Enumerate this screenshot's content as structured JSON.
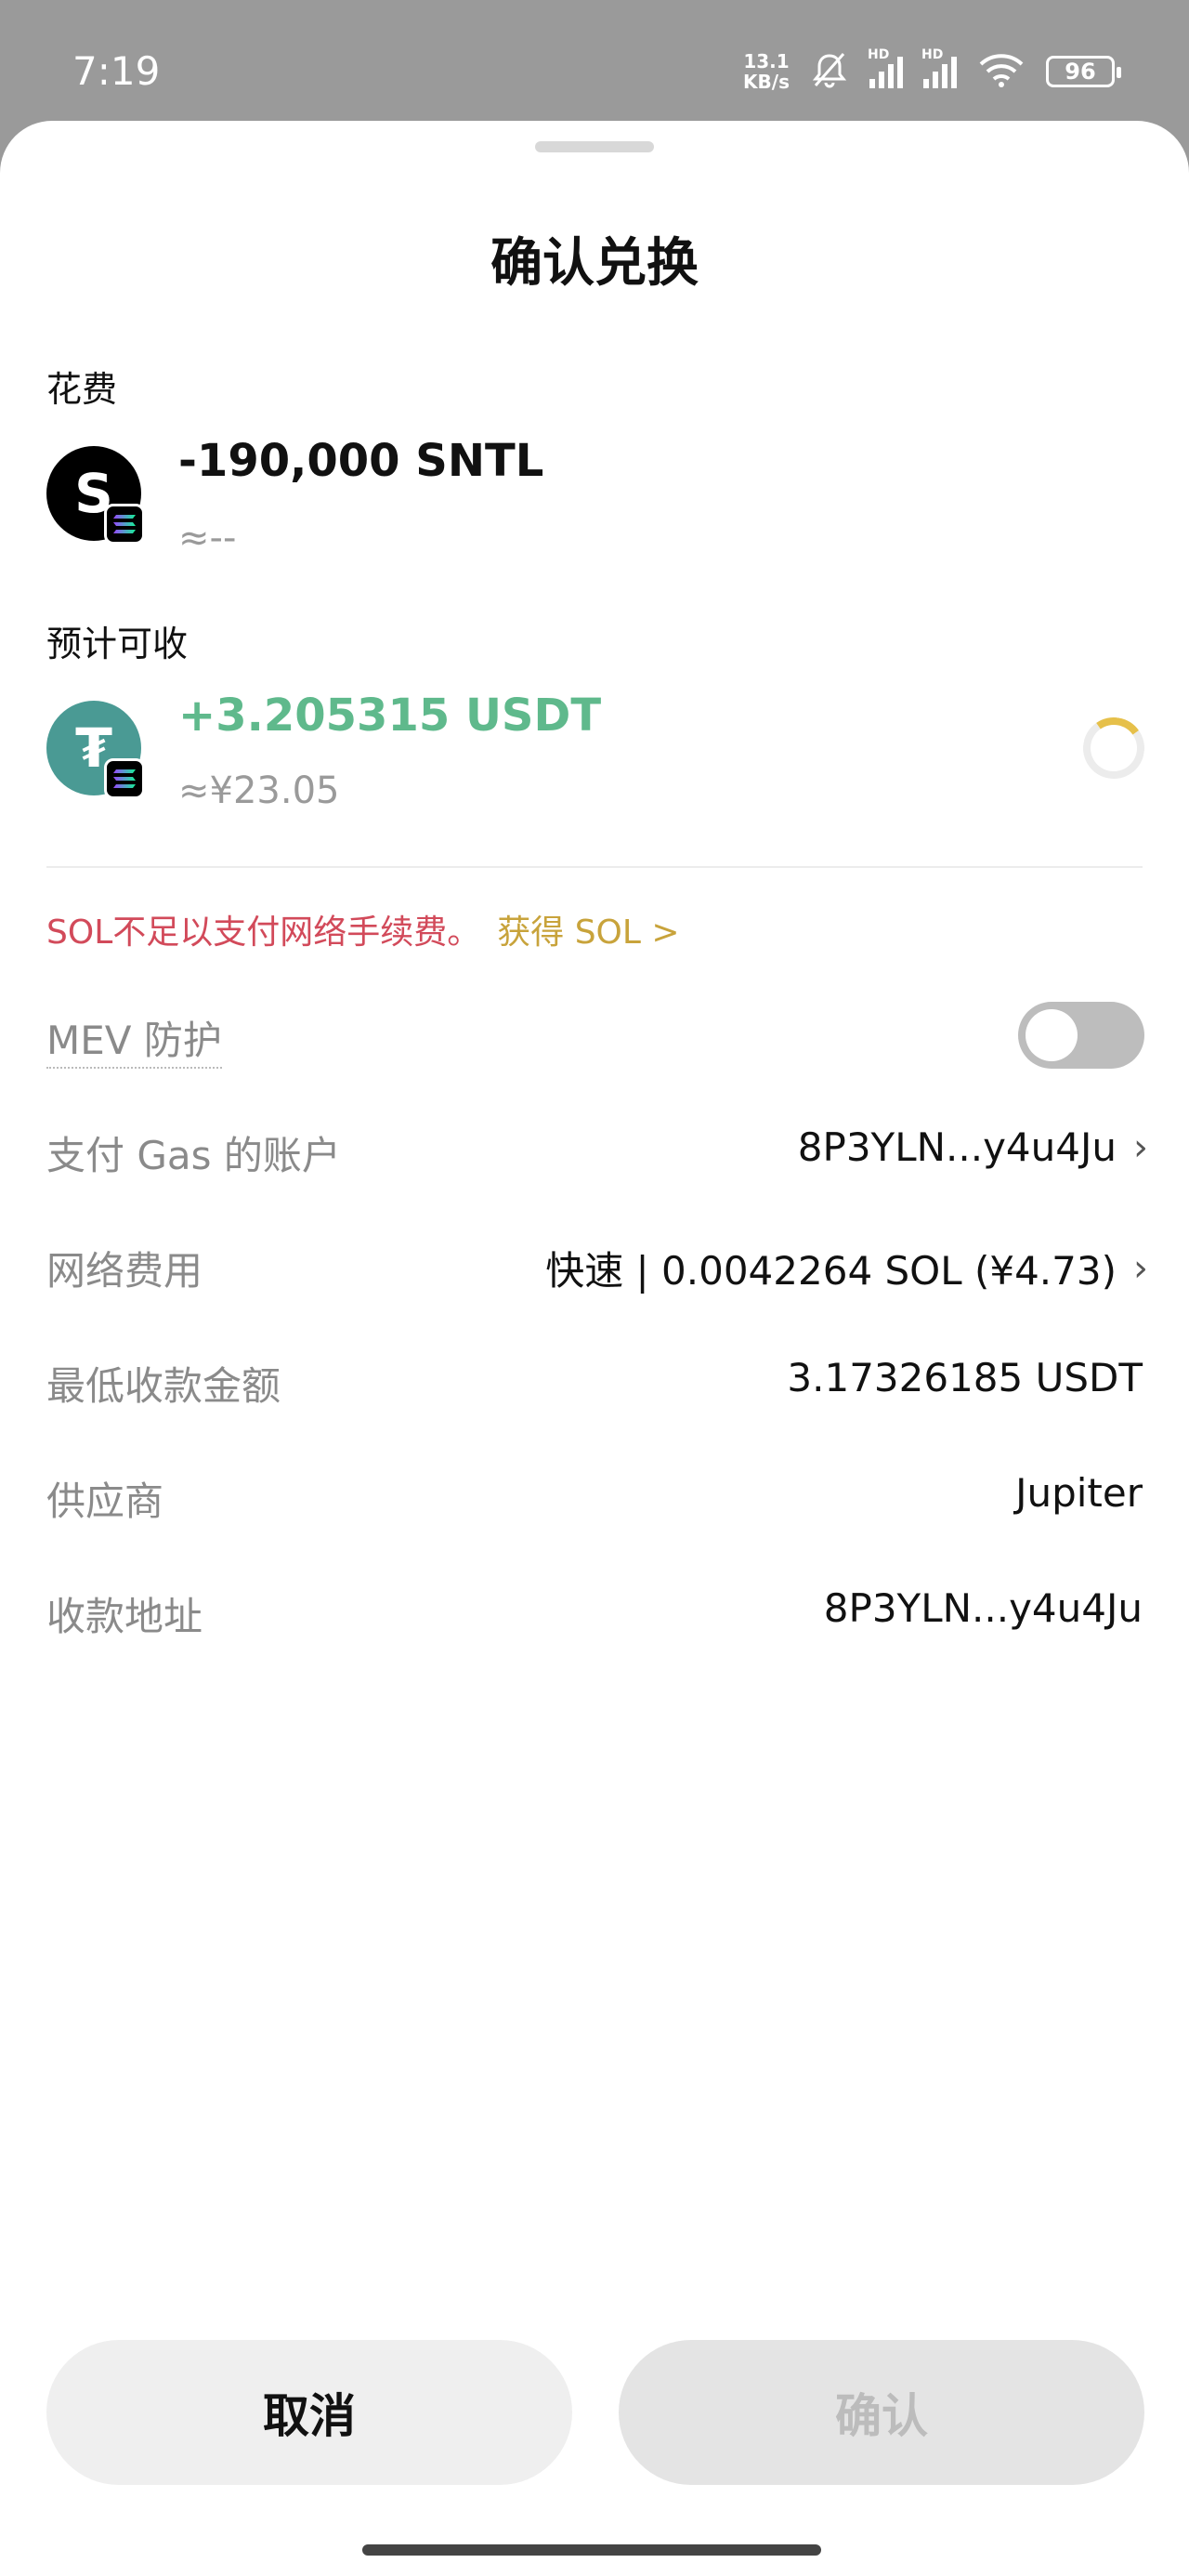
{
  "status": {
    "time": "7:19",
    "net_speed_top": "13.1",
    "net_speed_unit": "KB/s",
    "hd": "HD",
    "battery": "96"
  },
  "sheet": {
    "title": "确认兑换",
    "spend_label": "花费",
    "spend_amount": "-190,000 SNTL",
    "spend_fiat": "≈--",
    "spend_token_letter": "S",
    "receive_label": "预计可收",
    "receive_amount": "+3.205315 USDT",
    "receive_fiat": "≈¥23.05",
    "receive_token_letter": "₮",
    "warning_text": "SOL不足以支付网络手续费。",
    "warning_link": "获得 SOL >"
  },
  "details": {
    "mev_label": "MEV 防护",
    "gas_account_label": "支付 Gas 的账户",
    "gas_account_value": "8P3YLN...y4u4Ju",
    "network_fee_label": "网络费用",
    "network_fee_value": "快速 | 0.0042264 SOL (¥4.73)",
    "min_receive_label": "最低收款金额",
    "min_receive_value": "3.17326185 USDT",
    "provider_label": "供应商",
    "provider_value": "Jupiter",
    "receive_address_label": "收款地址",
    "receive_address_value": "8P3YLN...y4u4Ju",
    "chevron": "›"
  },
  "buttons": {
    "cancel": "取消",
    "confirm": "确认"
  },
  "colors": {
    "receive_green": "#5fb98c",
    "warning_red": "#d24a5a",
    "link_gold": "#c8a33b",
    "usdt_teal": "#4a9a94"
  }
}
